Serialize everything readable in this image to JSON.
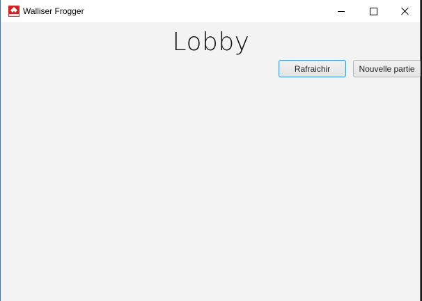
{
  "window": {
    "title": "Walliser Frogger",
    "app_icon": "frogger-app-icon",
    "controls": {
      "minimize_icon": "minimize-icon",
      "maximize_icon": "maximize-icon",
      "close_icon": "close-icon"
    }
  },
  "main": {
    "heading": "Lobby",
    "refresh_label": "Rafraichir",
    "new_game_label": "Nouvelle partie"
  },
  "colors": {
    "titlebar_bg": "#ffffff",
    "content_bg": "#f3f3f3",
    "focus_border": "#3a9bd8",
    "app_icon_red": "#d32020"
  }
}
